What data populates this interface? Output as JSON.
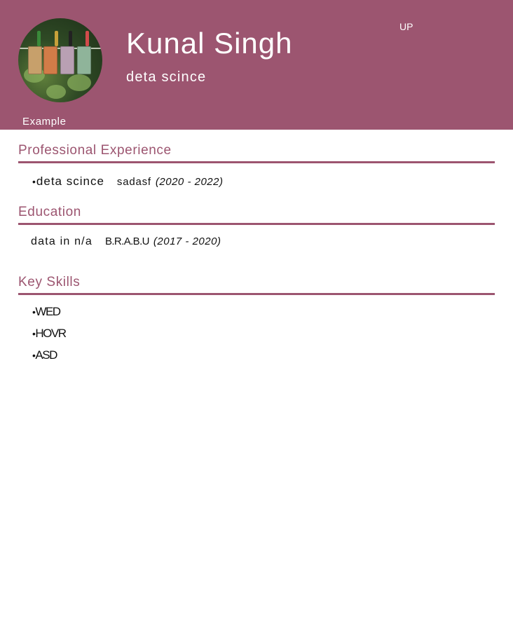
{
  "header": {
    "name": "Kunal Singh",
    "headline": "deta scince",
    "location": "UP",
    "avatar_caption": "Example",
    "background_color": "#9c5570"
  },
  "experience": {
    "heading": "Professional Experience",
    "items": [
      {
        "title": "deta scince",
        "organization": "sadasf",
        "dates": "(2020 - 2022)"
      }
    ]
  },
  "education": {
    "heading": "Education",
    "items": [
      {
        "degree": "data in n/a",
        "school": "B.R.A.B.U",
        "dates": "(2017 - 2020)"
      }
    ]
  },
  "skills": {
    "heading": "Key Skills",
    "items": [
      "WED",
      "HOVR",
      "ASD"
    ]
  },
  "accent_color": "#9c5570"
}
